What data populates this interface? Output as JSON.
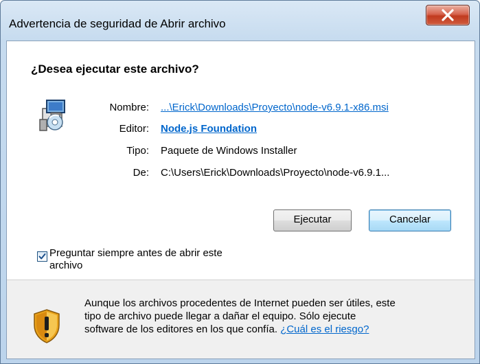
{
  "window": {
    "title": "Advertencia de seguridad de Abrir archivo"
  },
  "dialog": {
    "heading": "¿Desea ejecutar este archivo?",
    "fields": [
      {
        "label": "Nombre:",
        "value": "...\\Erick\\Downloads\\Proyecto\\node-v6.9.1-x86.msi"
      },
      {
        "label": "Editor:",
        "value": "Node.js Foundation"
      },
      {
        "label": "Tipo:",
        "value": "Paquete de Windows Installer"
      },
      {
        "label": "De:",
        "value": "C:\\Users\\Erick\\Downloads\\Proyecto\\node-v6.9.1..."
      }
    ],
    "buttons": {
      "run": "Ejecutar",
      "cancel": "Cancelar"
    },
    "checkbox": {
      "checked": true,
      "line1": "Preguntar siempre antes de abrir este",
      "line2": "archivo"
    }
  },
  "warning": {
    "line1": "Aunque los archivos procedentes de Internet pueden ser útiles, este",
    "line2": "tipo de archivo puede llegar a dañar el equipo. Sólo ejecute",
    "line3": "software de los editores en los que confía.",
    "link": "¿Cuál es el riesgo?"
  },
  "icons": [
    "close-icon",
    "installer-package-icon",
    "checkmark-icon",
    "warning-shield-icon"
  ]
}
